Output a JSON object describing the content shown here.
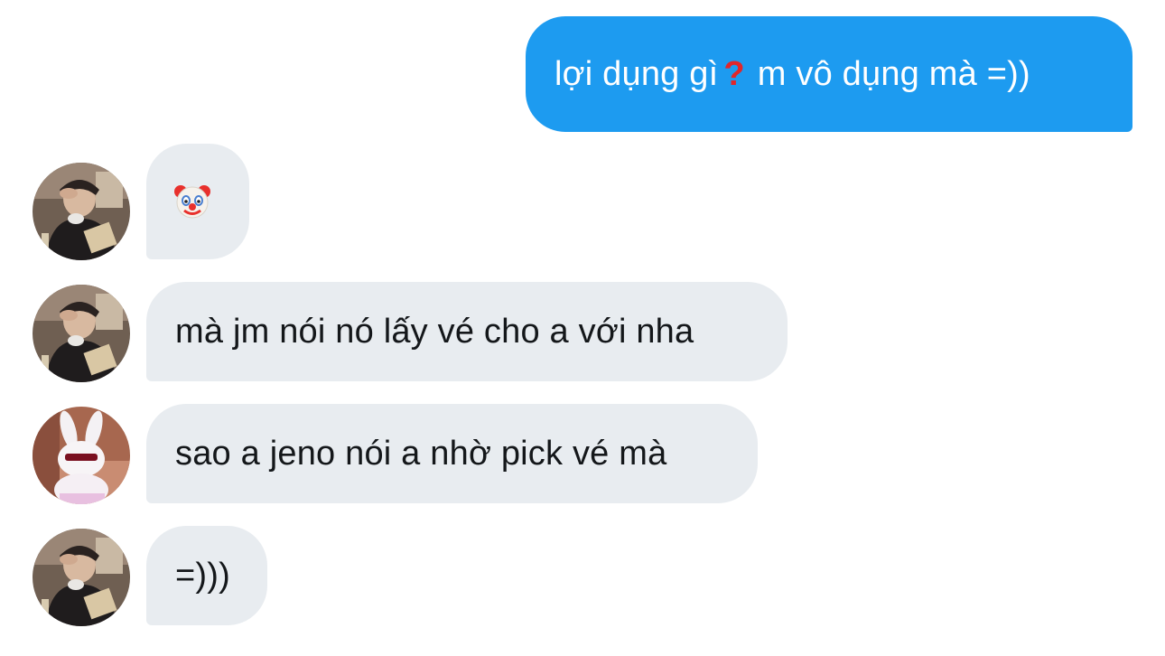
{
  "conversation": {
    "messages": [
      {
        "direction": "outgoing",
        "text_before": "lợi dụng gì",
        "emoji": "question-mark-emoji",
        "text_after": "m vô dụng mà =))",
        "bubble_color": "#1d9bf0"
      },
      {
        "direction": "incoming",
        "sender_avatar": "person-avatar",
        "emoji": "clown-face-emoji",
        "bubble_color": "#e8ecf0"
      },
      {
        "direction": "incoming",
        "sender_avatar": "person-avatar",
        "text": "mà jm nói nó lấy vé cho a với nha",
        "bubble_color": "#e8ecf0"
      },
      {
        "direction": "incoming",
        "sender_avatar": "bunny-avatar",
        "text": "sao a jeno nói a nhờ pick vé mà",
        "bubble_color": "#e8ecf0"
      },
      {
        "direction": "incoming",
        "sender_avatar": "person-avatar",
        "text": "=)))",
        "bubble_color": "#e8ecf0"
      }
    ]
  }
}
